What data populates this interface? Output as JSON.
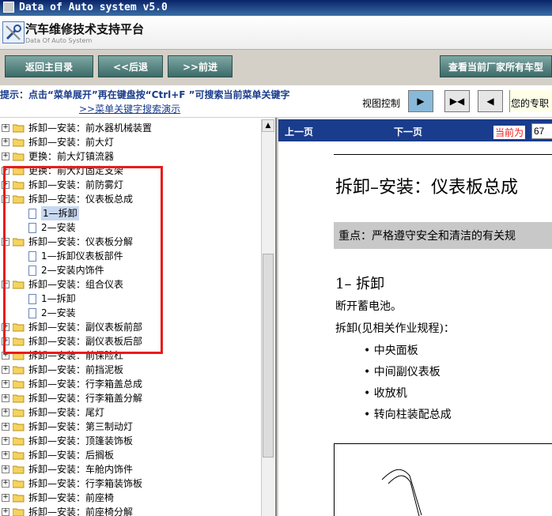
{
  "window": {
    "title": "Data of Auto system v5.0"
  },
  "app": {
    "title": "汽车维修技术支持平台",
    "subtitle": "Data Of Auto System"
  },
  "toolbar": {
    "home": "返回主目录",
    "back": "<<后退",
    "forward": ">>前进",
    "all_models": "查看当前厂家所有车型"
  },
  "hint": {
    "text": "提示：点击“菜单展开”再在键盘按“Ctrl+F ”可搜索当前菜单关键字",
    "link": ">>菜单关键字搜索演示",
    "view_control": "视图控制",
    "expert": "您的专职"
  },
  "tree": [
    {
      "label": "拆卸—安装：前水器机械装置",
      "level": 0,
      "type": "folder"
    },
    {
      "label": "拆卸—安装：前大灯",
      "level": 0,
      "type": "folder"
    },
    {
      "label": "更换：前大灯镇流器",
      "level": 0,
      "type": "folder"
    },
    {
      "label": "更换：前大灯固定支架",
      "level": 0,
      "type": "folder"
    },
    {
      "label": "拆卸—安装：前防雾灯",
      "level": 0,
      "type": "folder"
    },
    {
      "label": "拆卸—安装：仪表板总成",
      "level": 0,
      "type": "folder",
      "expanded": true
    },
    {
      "label": "1—拆卸",
      "level": 1,
      "type": "doc",
      "selected": true
    },
    {
      "label": "2—安装",
      "level": 1,
      "type": "doc"
    },
    {
      "label": "拆卸—安装：仪表板分解",
      "level": 0,
      "type": "folder",
      "expanded": true
    },
    {
      "label": "1—拆卸仪表板部件",
      "level": 1,
      "type": "doc"
    },
    {
      "label": "2—安装内饰件",
      "level": 1,
      "type": "doc"
    },
    {
      "label": "拆卸—安装：组合仪表",
      "level": 0,
      "type": "folder",
      "expanded": true
    },
    {
      "label": "1—拆卸",
      "level": 1,
      "type": "doc"
    },
    {
      "label": "2—安装",
      "level": 1,
      "type": "doc"
    },
    {
      "label": "拆卸—安装：副仪表板前部",
      "level": 0,
      "type": "folder"
    },
    {
      "label": "拆卸—安装：副仪表板后部",
      "level": 0,
      "type": "folder"
    },
    {
      "label": "拆卸—安装：前保险杠",
      "level": 0,
      "type": "folder"
    },
    {
      "label": "拆卸—安装：前挡泥板",
      "level": 0,
      "type": "folder"
    },
    {
      "label": "拆卸—安装：行李箱盖总成",
      "level": 0,
      "type": "folder"
    },
    {
      "label": "拆卸—安装：行李箱盖分解",
      "level": 0,
      "type": "folder"
    },
    {
      "label": "拆卸—安装：尾灯",
      "level": 0,
      "type": "folder"
    },
    {
      "label": "拆卸—安装：第三制动灯",
      "level": 0,
      "type": "folder"
    },
    {
      "label": "拆卸—安装：顶篷装饰板",
      "level": 0,
      "type": "folder"
    },
    {
      "label": "拆卸—安装：后搁板",
      "level": 0,
      "type": "folder"
    },
    {
      "label": "拆卸—安装：车舱内饰件",
      "level": 0,
      "type": "folder"
    },
    {
      "label": "拆卸—安装：行李箱装饰板",
      "level": 0,
      "type": "folder"
    },
    {
      "label": "拆卸—安装：前座椅",
      "level": 0,
      "type": "folder"
    },
    {
      "label": "拆卸—安装：前座椅分解",
      "level": 0,
      "type": "folder"
    }
  ],
  "docnav": {
    "prev": "上一页",
    "next": "下一页",
    "current_label": "当前为",
    "current_value": "67"
  },
  "document": {
    "title": "拆卸–安装：仪表板总成",
    "note": "重点：严格遵守安全和清洁的有关规",
    "section": "1– 拆卸",
    "line1": "断开蓄电池。",
    "line2": "拆卸(见相关作业规程)：",
    "bullets": [
      "中央面板",
      "中间副仪表板",
      "收放机",
      "转向柱装配总成"
    ]
  }
}
